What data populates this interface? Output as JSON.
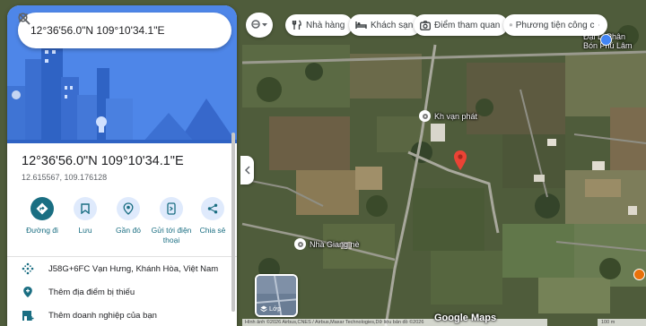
{
  "search": {
    "query": "12°36'56.0\"N 109°10'34.1\"E"
  },
  "place": {
    "title": "12°36'56.0\"N 109°10'34.1\"E",
    "decimal_coords": "12.615567, 109.176128"
  },
  "actions": [
    {
      "label": "Đường đi",
      "icon": "directions-icon"
    },
    {
      "label": "Lưu",
      "icon": "bookmark-icon"
    },
    {
      "label": "Gần đó",
      "icon": "nearby-icon"
    },
    {
      "label": "Gửi tới điện thoại",
      "icon": "send-to-phone-icon"
    },
    {
      "label": "Chia sẻ",
      "icon": "share-icon"
    }
  ],
  "info_rows": [
    {
      "text": "J58G+6FC Vạn Hưng, Khánh Hòa, Việt Nam",
      "icon": "plus-code-icon"
    },
    {
      "text": "Thêm địa điểm bị thiếu",
      "icon": "add-place-icon"
    },
    {
      "text": "Thêm doanh nghiệp của bạn",
      "icon": "add-business-icon"
    }
  ],
  "chips": [
    {
      "label": "Nhà hàng",
      "icon": "restaurant-icon"
    },
    {
      "label": "Khách sạn",
      "icon": "hotel-icon"
    },
    {
      "label": "Điểm tham quan",
      "icon": "camera-icon"
    },
    {
      "label": "Phương tiện công c",
      "icon": "transit-icon"
    }
  ],
  "map_labels": {
    "poi_1": "Kh vạn phát",
    "poi_2": "Nhà Giang nè",
    "top_right_1": "Đại Lí Phân",
    "top_right_2": "Bón Phú Lâm"
  },
  "layers": {
    "label": "Lớp"
  },
  "footer": {
    "logo": "Google Maps",
    "attribution": "Hình ảnh ©2026 Airbus,CNES / Airbus,Maxar Technologies,Dữ liệu bản đồ ©2026",
    "scale": "100 m"
  },
  "colors": {
    "accent": "#1a6e82",
    "action_bg": "#dfeafc",
    "hero_bg": "#4e86e8",
    "pin": "#ea4335"
  }
}
